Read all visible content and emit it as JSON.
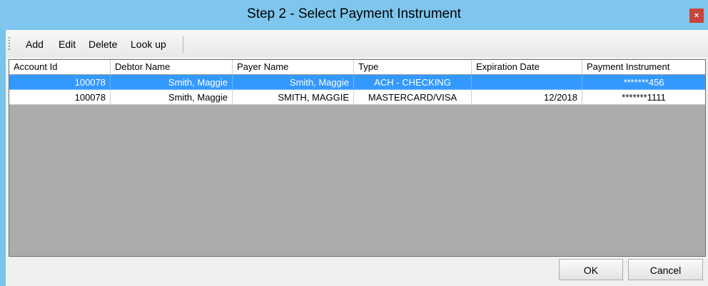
{
  "window": {
    "title": "Step 2 - Select Payment Instrument",
    "close_glyph": "×"
  },
  "toolbar": {
    "items": [
      "Add",
      "Edit",
      "Delete",
      "Look up"
    ]
  },
  "grid": {
    "columns": [
      "Account Id",
      "Debtor Name",
      "Payer Name",
      "Type",
      "Expiration Date",
      "Payment Instrument"
    ],
    "rows": [
      {
        "account_id": "100078",
        "debtor_name": "Smith, Maggie",
        "payer_name": "Smith, Maggie",
        "type": "ACH - CHECKING",
        "expiration_date": "",
        "payment_instrument": "*******456",
        "selected": true
      },
      {
        "account_id": "100078",
        "debtor_name": "Smith, Maggie",
        "payer_name": "SMITH, MAGGIE",
        "type": "MASTERCARD/VISA",
        "expiration_date": "12/2018",
        "payment_instrument": "*******1111",
        "selected": false
      }
    ]
  },
  "buttons": {
    "ok": "OK",
    "cancel": "Cancel"
  },
  "colors": {
    "titlebar": "#7ec6ee",
    "selection": "#3399ff",
    "grid_background": "#ababab"
  }
}
